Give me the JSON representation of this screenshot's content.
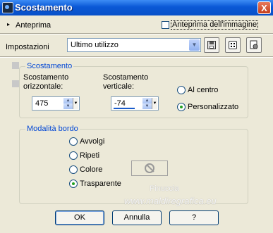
{
  "window": {
    "title": "Scostamento",
    "close_label": "X"
  },
  "preview": {
    "expand_icon": "▸",
    "label": "Anteprima",
    "image_preview_label": "Anteprima dell'immagine",
    "image_preview_checked": false
  },
  "settings": {
    "label": "Impostazioni",
    "preset_value": "Ultimo utilizzo",
    "dropdown_icon": "▼"
  },
  "offset": {
    "group_label": "Scostamento",
    "horizontal_label": "Scostamento orizzontale:",
    "horizontal_value": "475",
    "vertical_label": "Scostamento verticale:",
    "vertical_value": "-74",
    "spin_up": "▲",
    "spin_down": "▼",
    "options": [
      {
        "label": "Al centro",
        "selected": false
      },
      {
        "label": "Personalizzato",
        "selected": true
      }
    ]
  },
  "edge_mode": {
    "group_label": "Modalità bordo",
    "options": [
      {
        "label": "Avvolgi",
        "selected": false
      },
      {
        "label": "Ripeti",
        "selected": false
      },
      {
        "label": "Colore",
        "selected": false
      },
      {
        "label": "Trasparente",
        "selected": true
      }
    ]
  },
  "watermark": {
    "line1": "Pinuccia",
    "line2": "www.maldiregrafica.eu"
  },
  "buttons": {
    "ok": "OK",
    "cancel": "Annulla",
    "help": "?"
  },
  "colors": {
    "title_bar": "#0a58d6",
    "group_label": "#0046d5",
    "background": "#ece9d8"
  }
}
